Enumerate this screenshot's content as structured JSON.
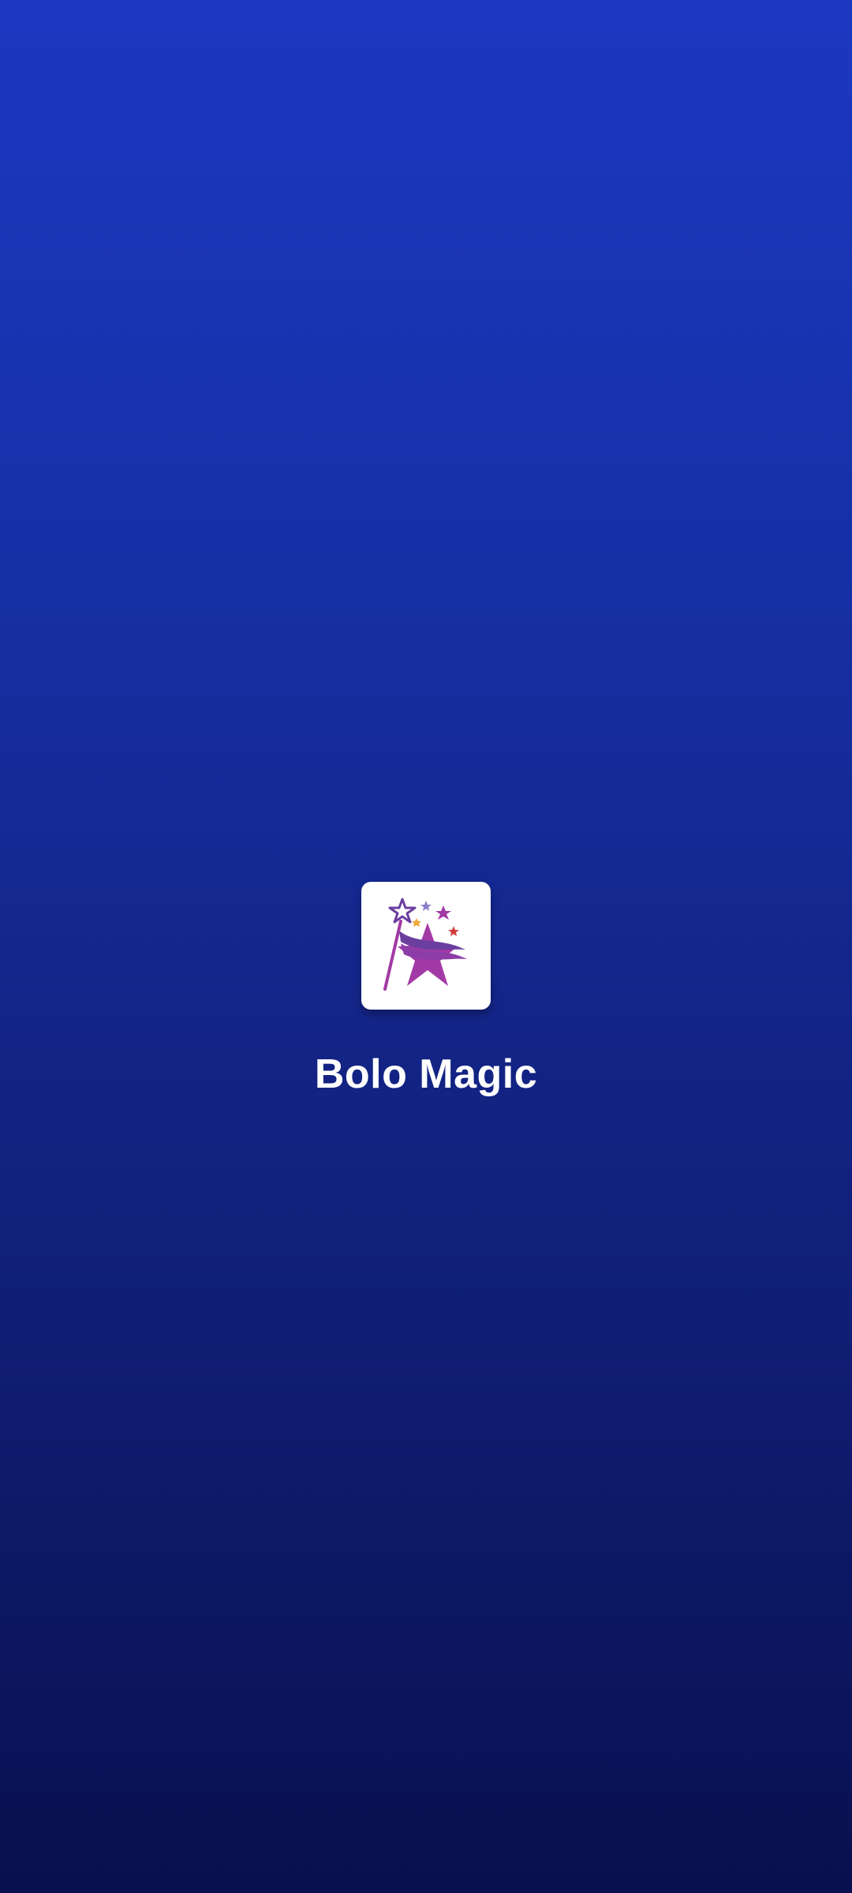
{
  "splash": {
    "app_name": "Bolo Magic",
    "logo_icon": "magic-wand-star-icon"
  },
  "colors": {
    "background_top": "#1c38c1",
    "background_bottom": "#09104f",
    "logo_purple": "#a23aa5",
    "logo_violet": "#6b3fa0",
    "logo_lavender": "#8c7cc9",
    "logo_orange": "#f0a93a",
    "logo_red": "#d23b3b",
    "text": "#ffffff"
  }
}
